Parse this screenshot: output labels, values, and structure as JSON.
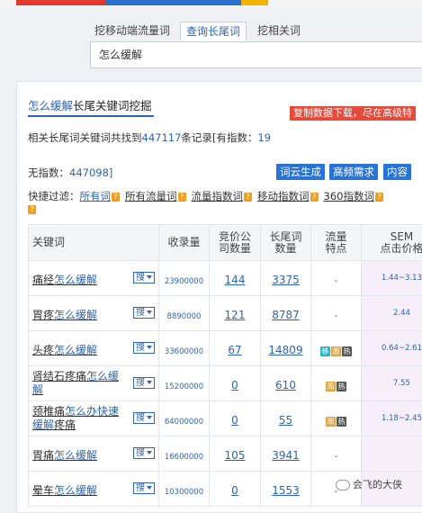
{
  "tabs": [
    "挖移动端流量词",
    "查询长尾词",
    "挖相关词"
  ],
  "search": {
    "value": "怎么缓解"
  },
  "panel": {
    "title_keyword": "怎么缓解",
    "title_suffix": "长尾关键词挖掘",
    "copy_banner": "复制数据下载，尽在高级特",
    "summary_prefix": "相关长尾词关键词共找到",
    "summary_count": "447117",
    "summary_mid": "条记录[有指数：",
    "summary_indexed": "19",
    "noindex_label": "无指数：",
    "noindex_count": "447098]",
    "buttons": [
      "词云生成",
      "高频需求",
      "内容"
    ],
    "filter_label": "快捷过滤：",
    "filters": [
      "所有词",
      "所有流量词",
      "流量指数词",
      "移动指数词",
      "360指数词"
    ],
    "help_glyph": "?"
  },
  "table": {
    "headers": {
      "keyword": "关键词",
      "records": "收录量",
      "bid": [
        "竞价公",
        "司数量"
      ],
      "longtail": [
        "长尾词",
        "数量"
      ],
      "traffic": [
        "流量",
        "特点"
      ],
      "sem": [
        "SEM",
        "点击价格"
      ]
    },
    "search_btn": "搜",
    "rows": [
      {
        "prefix": "痛经",
        "hl": "怎么缓解",
        "records": "23900000",
        "bid": "144",
        "longtail": "3375",
        "traffic": "-",
        "tags": [],
        "sem": "1.44~3.13"
      },
      {
        "prefix": "胃疼",
        "hl": "怎么缓解",
        "records": "8890000",
        "bid": "121",
        "longtail": "8787",
        "traffic": "-",
        "tags": [],
        "sem": "2.44"
      },
      {
        "prefix": "头疼",
        "hl": "怎么缓解",
        "records": "33600000",
        "bid": "67",
        "longtail": "14809",
        "traffic": "",
        "tags": [
          "移",
          "周",
          "热"
        ],
        "sem": "0.64~2.61"
      },
      {
        "prefix": "肾结石疼痛",
        "hl": "怎么缓解",
        "records": "15200000",
        "bid": "0",
        "longtail": "610",
        "traffic": "",
        "tags": [
          "周",
          "热"
        ],
        "sem": "7.55"
      },
      {
        "prefix": "颈椎痛",
        "hl": "怎么办快速缓解",
        "suffix": "疼痛",
        "records": "64000000",
        "bid": "0",
        "longtail": "55",
        "traffic": "",
        "tags": [
          "周",
          "热"
        ],
        "sem": "1.18~2.45"
      },
      {
        "prefix": "胃痛",
        "hl": "怎么缓解",
        "records": "16600000",
        "bid": "105",
        "longtail": "3941",
        "traffic": "-",
        "tags": [],
        "sem": ""
      },
      {
        "prefix": "晕车",
        "hl": "怎么缓解",
        "records": "10300000",
        "bid": "0",
        "longtail": "1553",
        "traffic": "-",
        "tags": [],
        "sem": ""
      }
    ]
  },
  "watermark": "会飞的大侠"
}
